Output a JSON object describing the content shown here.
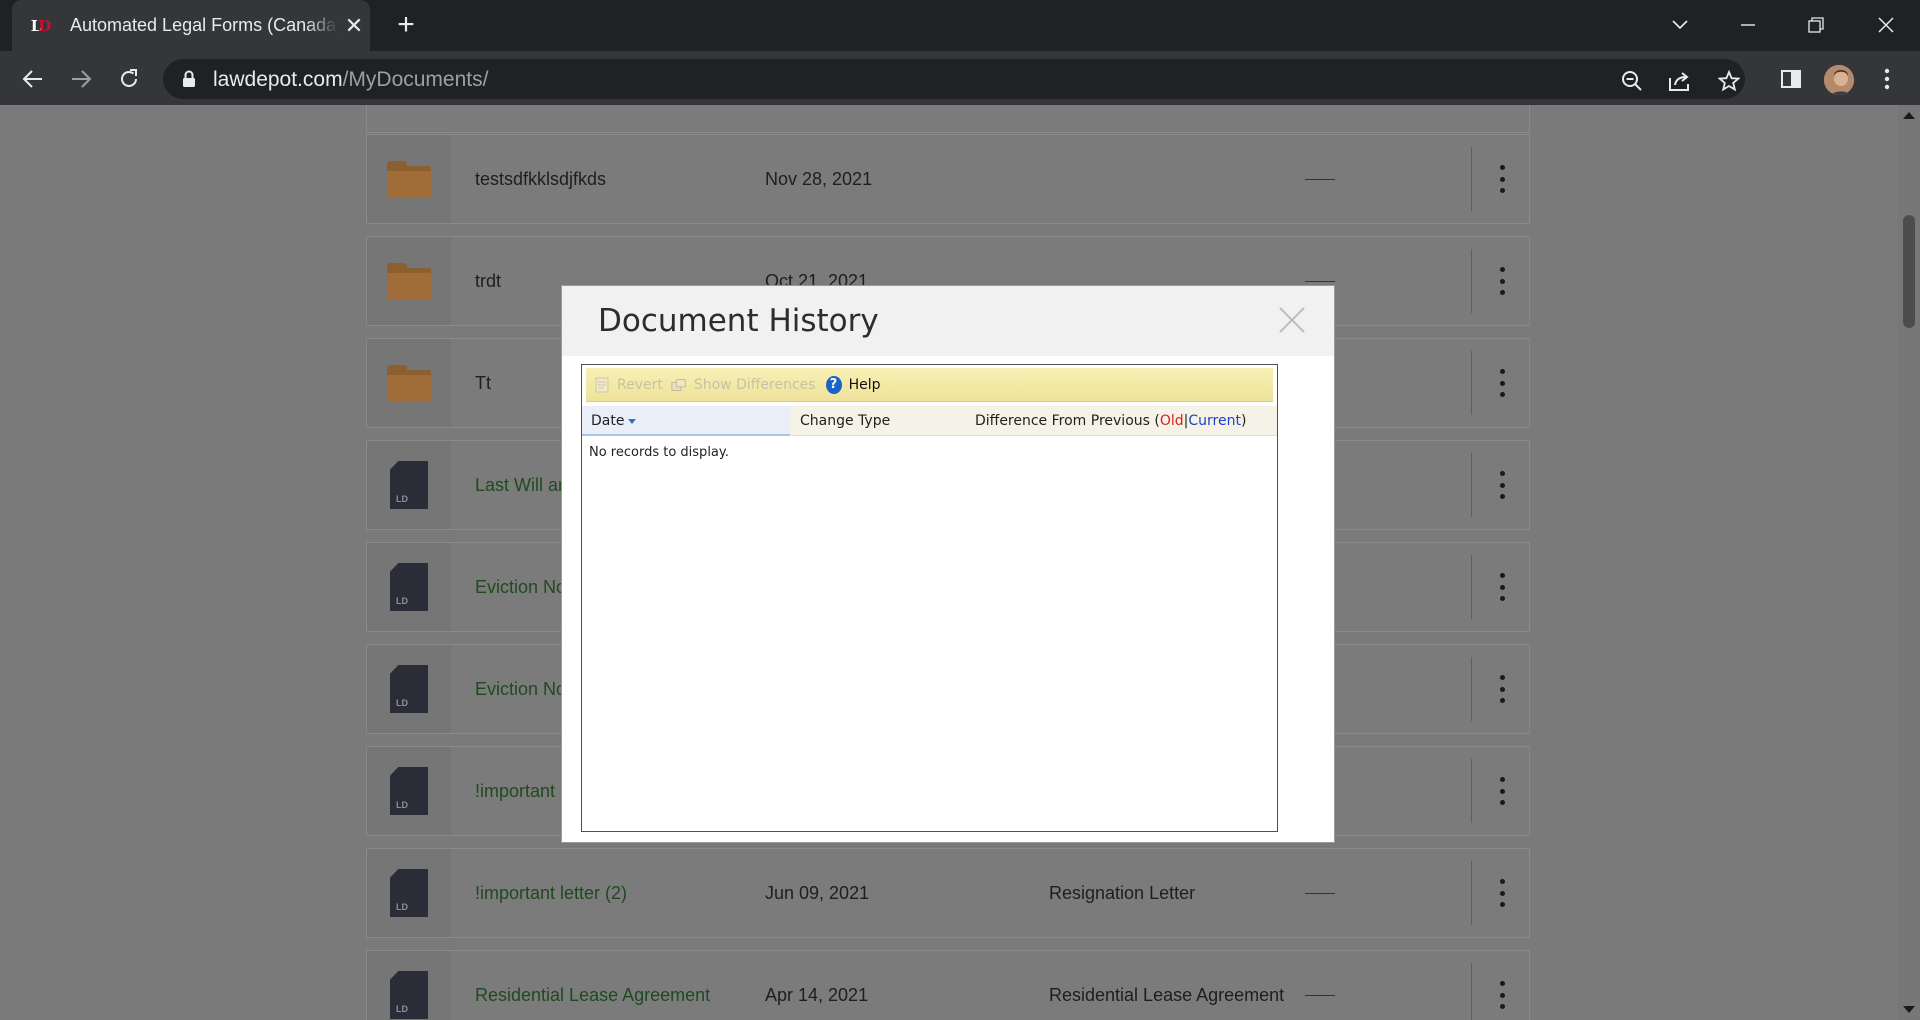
{
  "browser": {
    "tab_title": "Automated Legal Forms (Canada)",
    "url_domain": "lawdepot.com",
    "url_path": "/MyDocuments/",
    "favicon_letters": [
      "L",
      "D"
    ]
  },
  "documents": [
    {
      "kind": "folder",
      "name": "testsdfkklsdjfkds",
      "date": "Nov 28, 2021",
      "type": ""
    },
    {
      "kind": "folder",
      "name": "trdt",
      "date": "Oct 21, 2021",
      "type": ""
    },
    {
      "kind": "folder",
      "name": "Tt",
      "date": "",
      "type": ""
    },
    {
      "kind": "document",
      "name": "Last Will ar",
      "date": "",
      "type": ""
    },
    {
      "kind": "document",
      "name": "Eviction No",
      "date": "",
      "type": ""
    },
    {
      "kind": "document",
      "name": "Eviction No",
      "date": "",
      "type": ""
    },
    {
      "kind": "document",
      "name": "!important",
      "date": "",
      "type": ""
    },
    {
      "kind": "document",
      "name": "!important letter (2)",
      "date": "Jun 09, 2021",
      "type": "Resignation Letter"
    },
    {
      "kind": "document",
      "name": "Residential Lease Agreement",
      "date": "Apr 14, 2021",
      "type": "Residential Lease Agreement"
    }
  ],
  "doc_icon_label": "LD",
  "modal": {
    "title": "Document History",
    "toolbar": {
      "revert": "Revert",
      "show_differences": "Show Differences",
      "help": "Help"
    },
    "columns": {
      "date": "Date",
      "change_type": "Change Type",
      "difference_prefix": "Difference From Previous (",
      "old": "Old",
      "separator": "|",
      "current": "Current",
      "difference_suffix": ")"
    },
    "empty_message": "No records to display."
  },
  "colors": {
    "old": "#d52020",
    "current": "#1d3fc9",
    "toolbar_yellow": "#f3e9a6",
    "help_blue": "#1a63c4"
  }
}
